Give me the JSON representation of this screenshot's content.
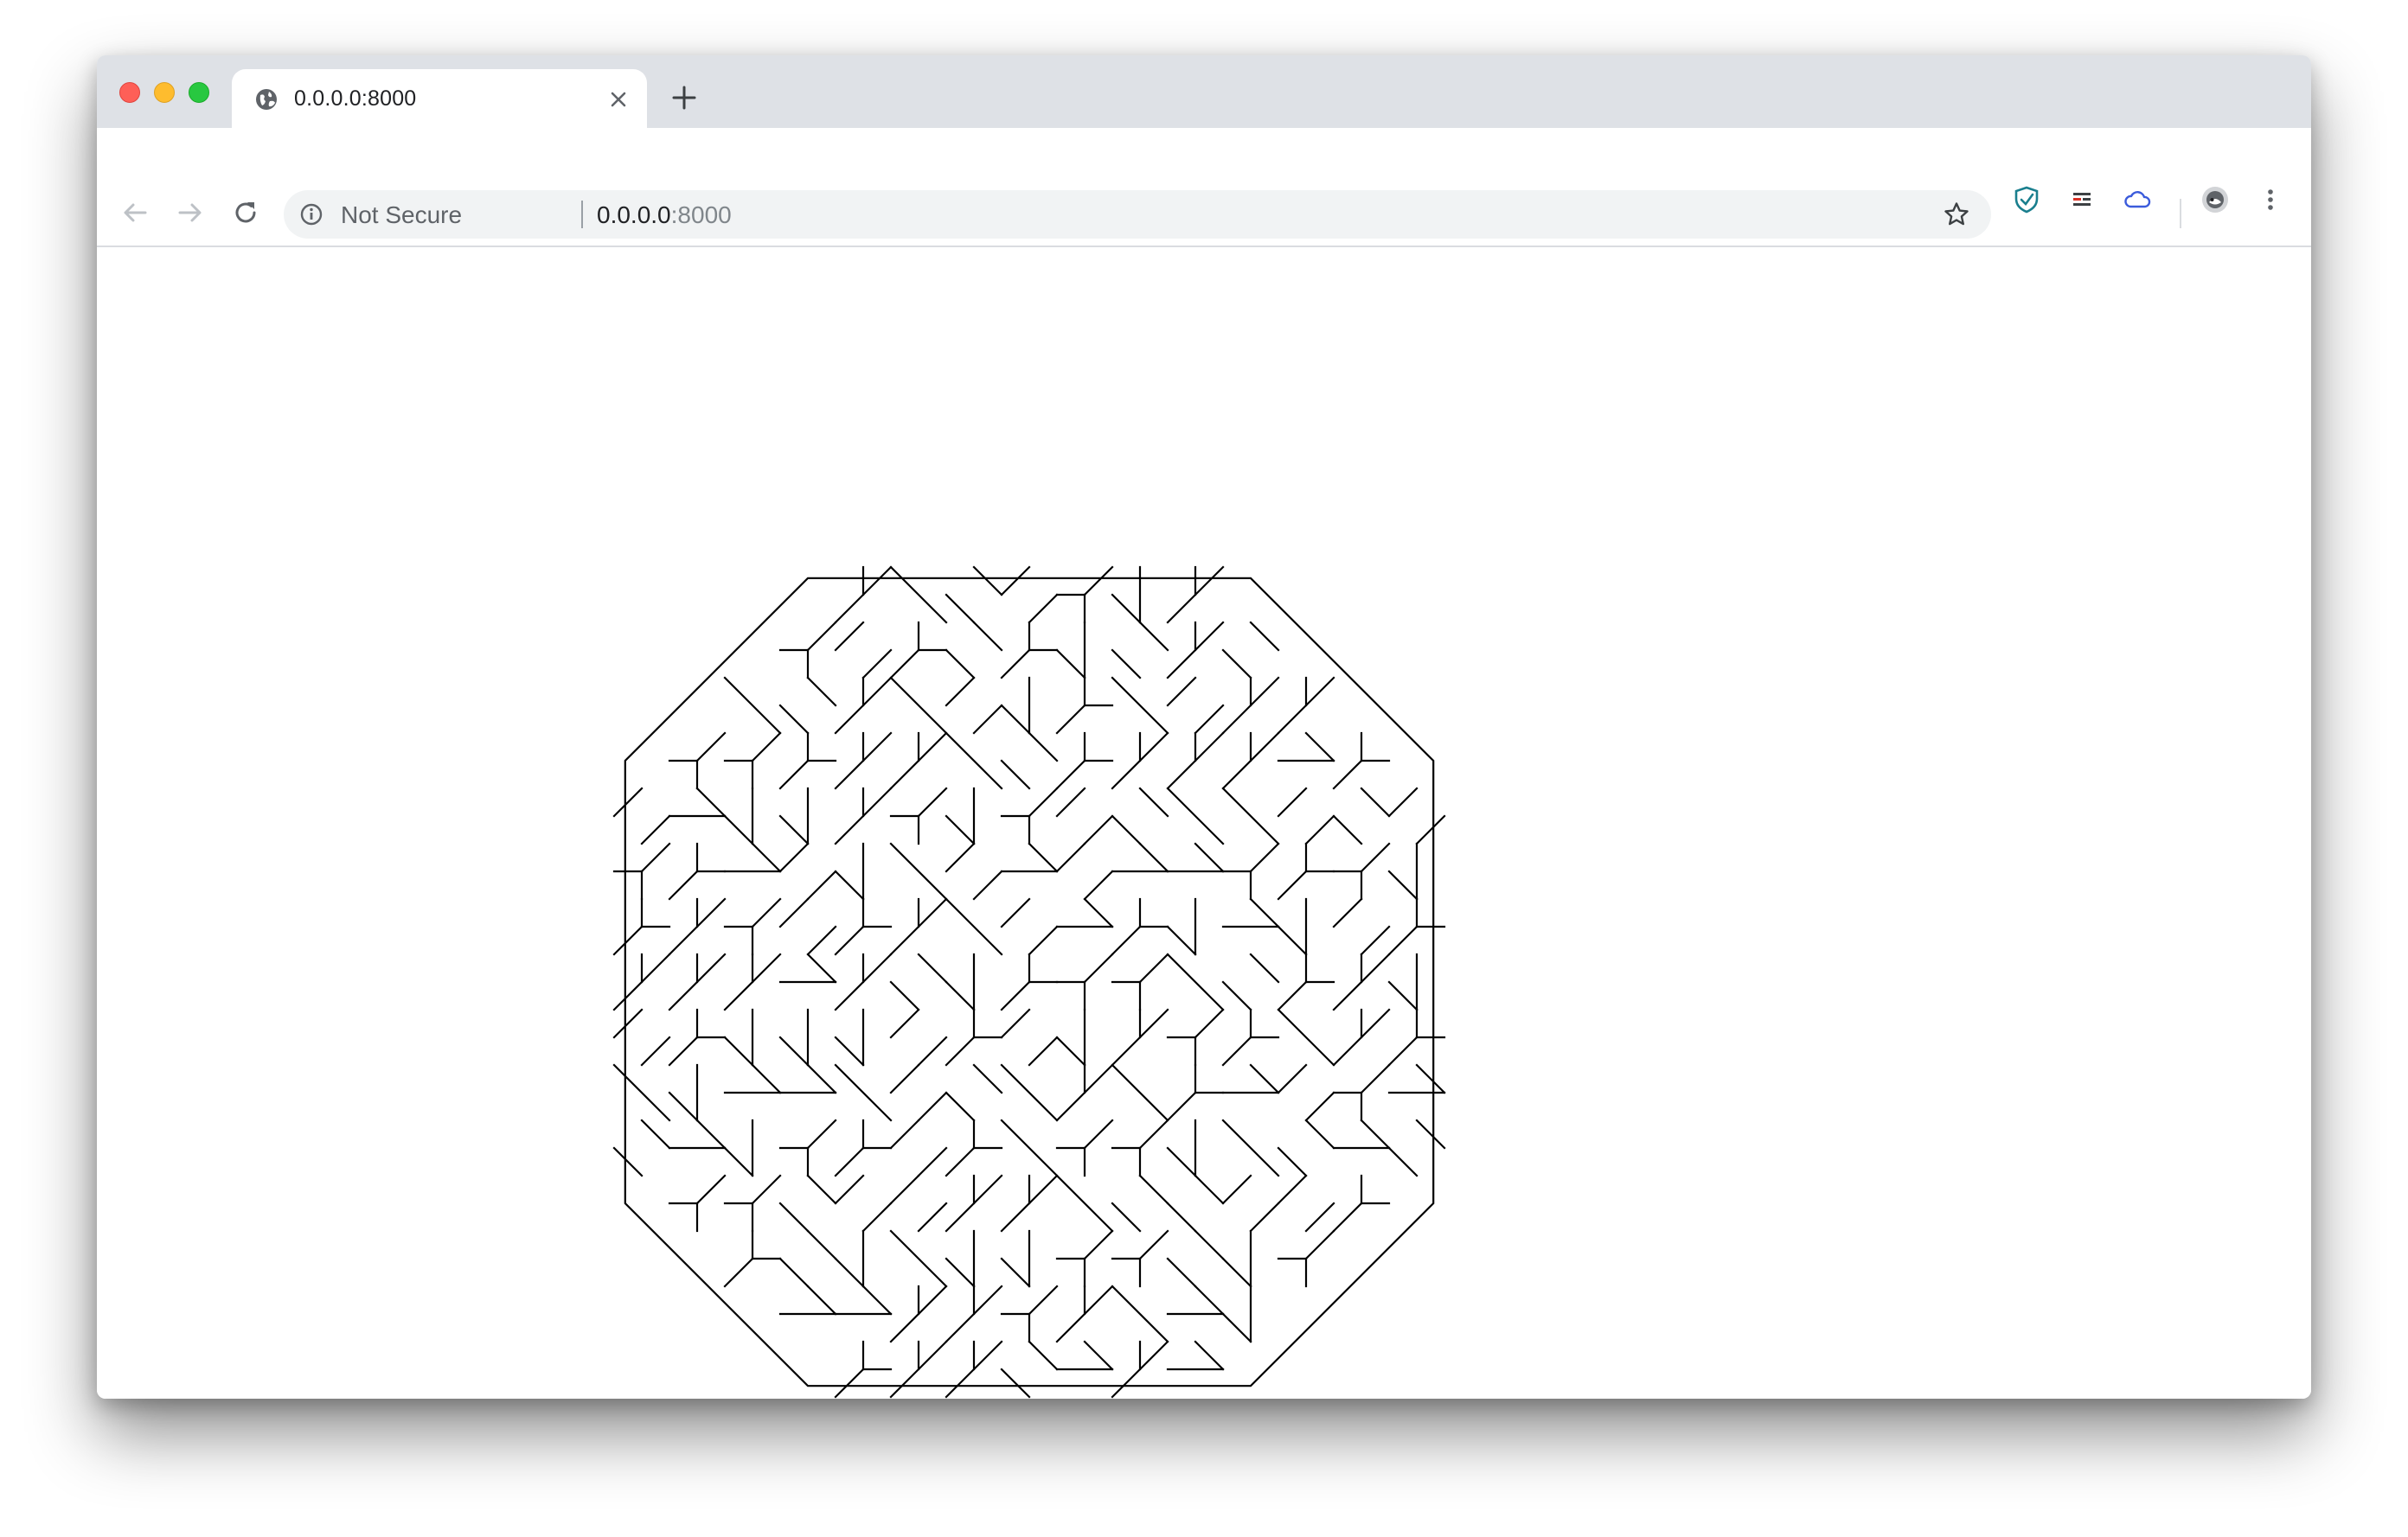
{
  "tab": {
    "title": "0.0.0.0:8000",
    "favicon": "globe-icon"
  },
  "omnibox": {
    "security_label": "Not Secure",
    "url_host": "0.0.0.0",
    "url_port": ":8000"
  },
  "toolbar": {
    "icons": [
      "back-arrow-icon",
      "forward-arrow-icon",
      "reload-icon",
      "info-icon",
      "star-icon",
      "shield-extension-icon",
      "flag-extension-icon",
      "cloud-extension-icon",
      "profile-avatar-icon",
      "kebab-menu-icon"
    ]
  },
  "colors": {
    "tabstrip_bg": "#dee1e6",
    "omnibox_bg": "#f1f3f4",
    "pattern_stroke": "#000000",
    "shield_icon": "#1a7f8e",
    "cloud_icon": "#3b5bdb"
  },
  "content": {
    "description_type": "maze-like octagonal line pattern",
    "stroke_color": "#000000"
  }
}
